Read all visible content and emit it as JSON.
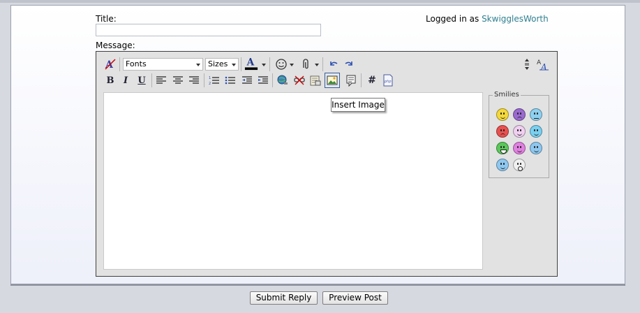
{
  "form": {
    "title_label": "Title:",
    "message_label": "Message:",
    "title_value": "",
    "message_value": ""
  },
  "login": {
    "prefix": "Logged in as",
    "username": "SkwigglesWorth"
  },
  "toolbar": {
    "fonts_select": "Fonts",
    "sizes_select": "Sizes",
    "tooltip": "Insert Image",
    "icons": [
      "remove-format-icon",
      "text-color-icon",
      "smiley-icon",
      "attachment-icon",
      "undo-icon",
      "redo-icon",
      "resize-arrows-icon",
      "switch-mode-icon",
      "bold-icon",
      "italic-icon",
      "underline-icon",
      "align-left-icon",
      "align-center-icon",
      "align-right-icon",
      "ordered-list-icon",
      "unordered-list-icon",
      "outdent-icon",
      "indent-icon",
      "insert-link-icon",
      "remove-link-icon",
      "insert-email-icon",
      "insert-image-icon",
      "quote-icon",
      "code-icon",
      "php-icon"
    ]
  },
  "smilies": {
    "legend": "Smilies",
    "items": [
      "smile",
      "purple-frown",
      "confused",
      "angry",
      "tongue",
      "wink",
      "grin",
      "purple-grin",
      "rolleyes",
      "cool",
      "shocked"
    ]
  },
  "buttons": {
    "submit": "Submit Reply",
    "preview": "Preview Post"
  },
  "colors": {
    "link": "#2f7f8f",
    "editor_bg": "#e2e2e2"
  }
}
